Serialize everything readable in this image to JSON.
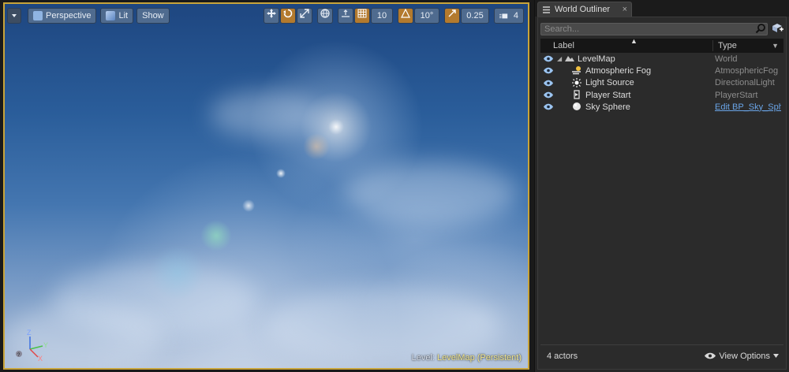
{
  "viewport": {
    "perspective_label": "Perspective",
    "lit_label": "Lit",
    "show_label": "Show",
    "grid_snap_value": "10",
    "rotation_snap_value": "10°",
    "scale_snap_value": "0.25",
    "camera_speed_value": "4",
    "level_prefix": "Level:",
    "level_name": "LevelMap (Persistent)",
    "axis_labels": {
      "z": "Z",
      "y": "Y",
      "x": "X"
    },
    "colors": {
      "selection_border": "#c8a43a",
      "toolbar_button": "#4f6b8f",
      "active_button": "#b37a2e"
    }
  },
  "outliner": {
    "tab_title": "World Outliner",
    "tab_close": "×",
    "search_placeholder": "Search...",
    "columns": {
      "label": "Label",
      "type": "Type"
    },
    "rows": [
      {
        "label": "LevelMap",
        "type": "World",
        "icon": "world-icon"
      },
      {
        "label": "Atmospheric Fog",
        "type": "AtmosphericFog",
        "icon": "fog-icon"
      },
      {
        "label": "Light Source",
        "type": "DirectionalLight",
        "icon": "sun-icon"
      },
      {
        "label": "Player Start",
        "type": "PlayerStart",
        "icon": "player-start-icon"
      },
      {
        "label": "Sky Sphere",
        "type": "Edit BP_Sky_Sphere",
        "icon": "sphere-icon"
      }
    ],
    "actor_count": "4 actors",
    "view_options": "View Options",
    "link_color": "#6aa5e8"
  }
}
